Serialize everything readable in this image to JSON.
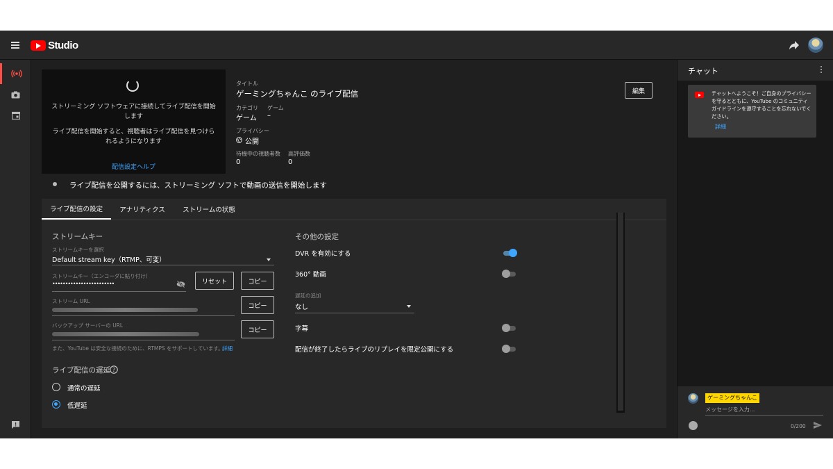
{
  "app": {
    "logo_text": "Studio"
  },
  "preview": {
    "line1": "ストリーミング ソフトウェアに接続してライブ配信を開始します",
    "line2": "ライブ配信を開始すると、視聴者はライブ配信を見つけられるようになります",
    "help_link": "配信設定ヘルプ"
  },
  "info": {
    "title_label": "タイトル",
    "title": "ゲーミングちゃんこ のライブ配信",
    "category_label": "カテゴリ",
    "category": "ゲーム",
    "game_label": "ゲーム",
    "game": "–",
    "privacy_label": "プライバシー",
    "privacy": "公開",
    "waiting_label": "待機中の視聴者数",
    "waiting": "0",
    "likes_label": "高評価数",
    "likes": "0",
    "edit_button": "編集"
  },
  "status": "ライブ配信を公開するには、ストリーミング ソフトで動画の送信を開始します",
  "tabs": [
    "ライブ配信の設定",
    "アナリティクス",
    "ストリームの状態"
  ],
  "stream_key": {
    "section_title": "ストリームキー",
    "select_label": "ストリームキーを選択",
    "select_value": "Default stream key（RTMP、可変）",
    "key_label": "ストリームキー（エンコーダに貼り付け）",
    "key_value": "••••••••••••••••••••••••",
    "reset_button": "リセット",
    "copy_button": "コピー",
    "url_label": "ストリーム URL",
    "backup_label": "バックアップ サーバーの URL",
    "rtmps_note": "また、YouTube は安全な接続のために、RTMPS をサポートしています。",
    "rtmps_link": "詳細"
  },
  "latency": {
    "section_title": "ライブ配信の遅延",
    "options": [
      "通常の遅延",
      "低遅延"
    ],
    "selected": "低遅延"
  },
  "other": {
    "section_title": "その他の設定",
    "dvr": "DVR を有効にする",
    "dvr_on": true,
    "360": "360° 動画",
    "360_on": false,
    "delay_label": "遅延の追加",
    "delay_value": "なし",
    "captions": "字幕",
    "captions_on": false,
    "unlisted": "配信が終了したらライブのリプレイを限定公開にする",
    "unlisted_on": false
  },
  "chat": {
    "title": "チャット",
    "welcome": "チャットへようこそ！ご自身のプライバシーを守るとともに、YouTube のコミュニティ ガイドラインを遵守することを忘れないでください。",
    "welcome_link": "詳細",
    "user": "ゲーミングちゃんこ",
    "placeholder": "メッセージを入力...",
    "counter": "0/200"
  },
  "colors": {
    "accent": "#3ea6ff",
    "brand_red": "#ff0000",
    "live_red": "#ff4e45",
    "username_bg": "#ffd600"
  }
}
